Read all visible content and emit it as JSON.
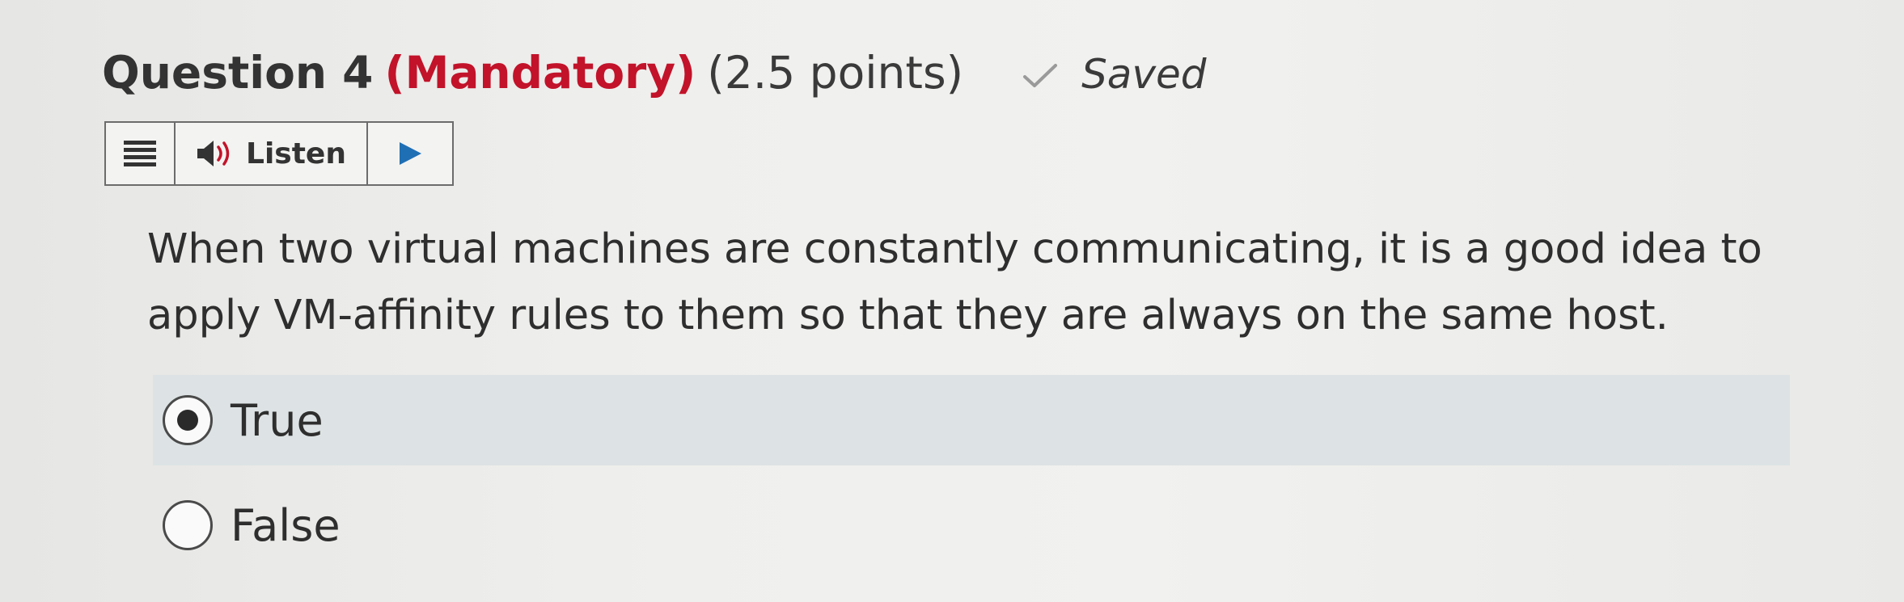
{
  "question": {
    "title": "Question 4",
    "mandatory": "(Mandatory)",
    "points": "(2.5 points)",
    "saved_label": "Saved",
    "text": "When two virtual machines are constantly communicating, it is a good idea to apply VM-affinity rules to them so that they are always on the same host."
  },
  "toolbar": {
    "listen_label": "Listen"
  },
  "options": [
    {
      "label": "True",
      "selected": true
    },
    {
      "label": "False",
      "selected": false
    }
  ],
  "colors": {
    "mandatory": "#c2132a",
    "selected_option_bg": "#dde3e4",
    "check_icon": "#9a9a9a",
    "play_icon": "#1f6fb5"
  }
}
